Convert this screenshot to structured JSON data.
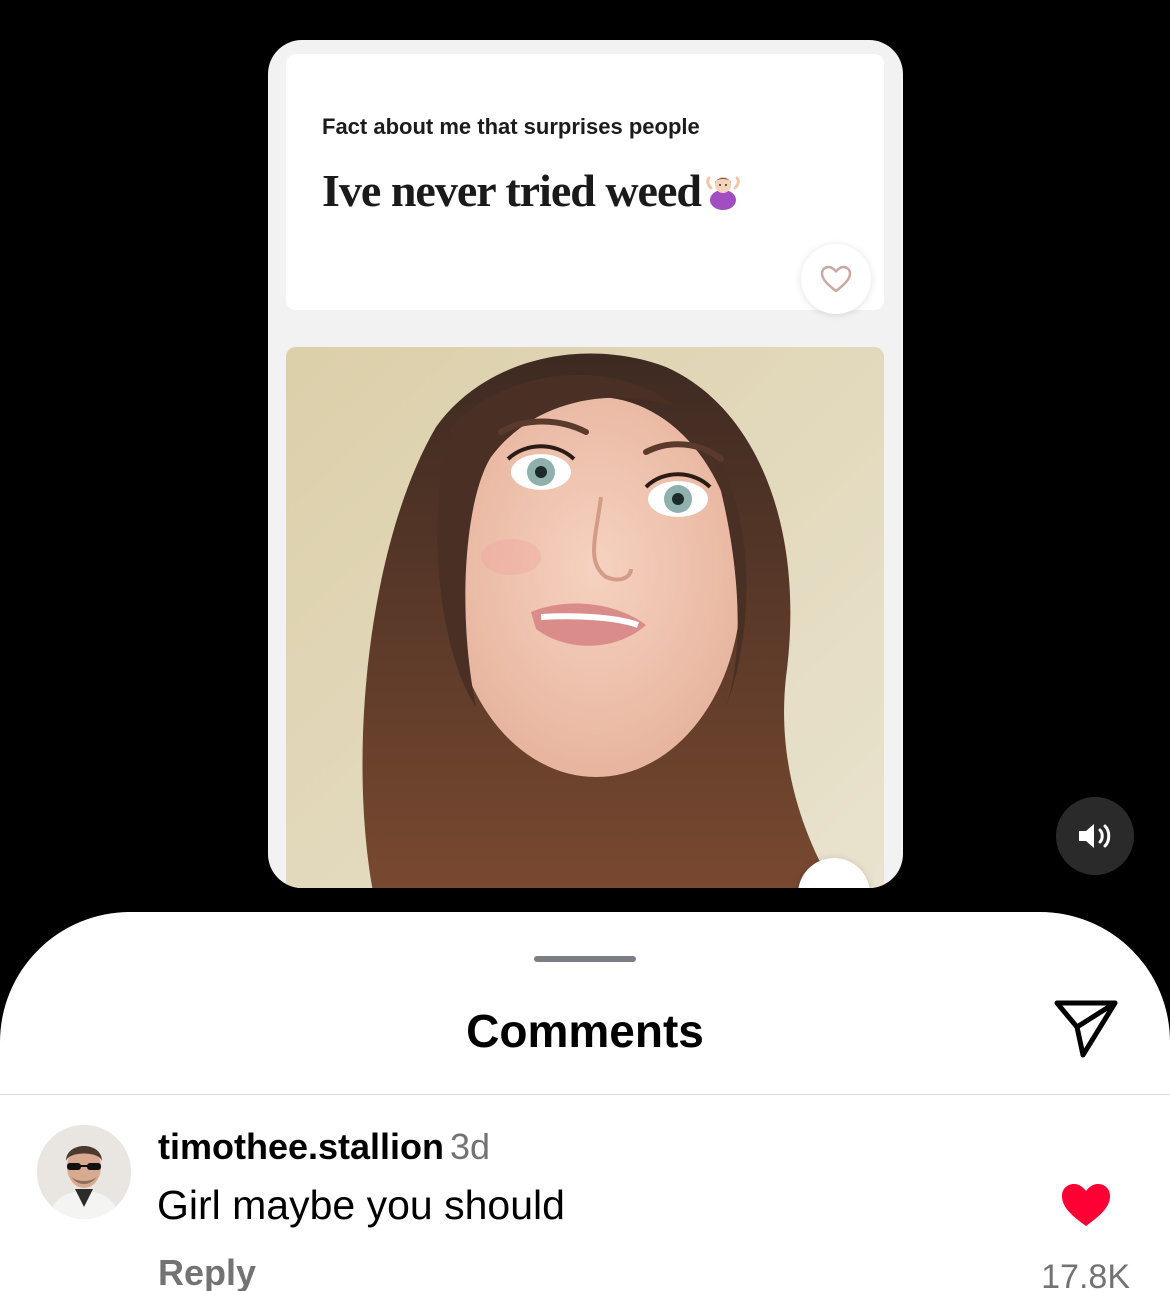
{
  "post": {
    "prompt_label": "Fact about me that surprises people",
    "prompt_answer": "Ive never tried weed",
    "answer_emoji_icon": "woman-shrugging-icon"
  },
  "controls": {
    "sound_icon": "speaker-on-icon"
  },
  "comments_sheet": {
    "title": "Comments",
    "share_icon": "paper-plane-icon",
    "comments": [
      {
        "username": "timothee.stallion",
        "time": "3d",
        "text": "Girl maybe you should",
        "reply_label": "Reply",
        "like_count": "17.8K",
        "liked": true
      }
    ]
  },
  "colors": {
    "background": "#000000",
    "sheet": "#ffffff",
    "muted_text": "#737373",
    "like_red": "#ff0034"
  }
}
